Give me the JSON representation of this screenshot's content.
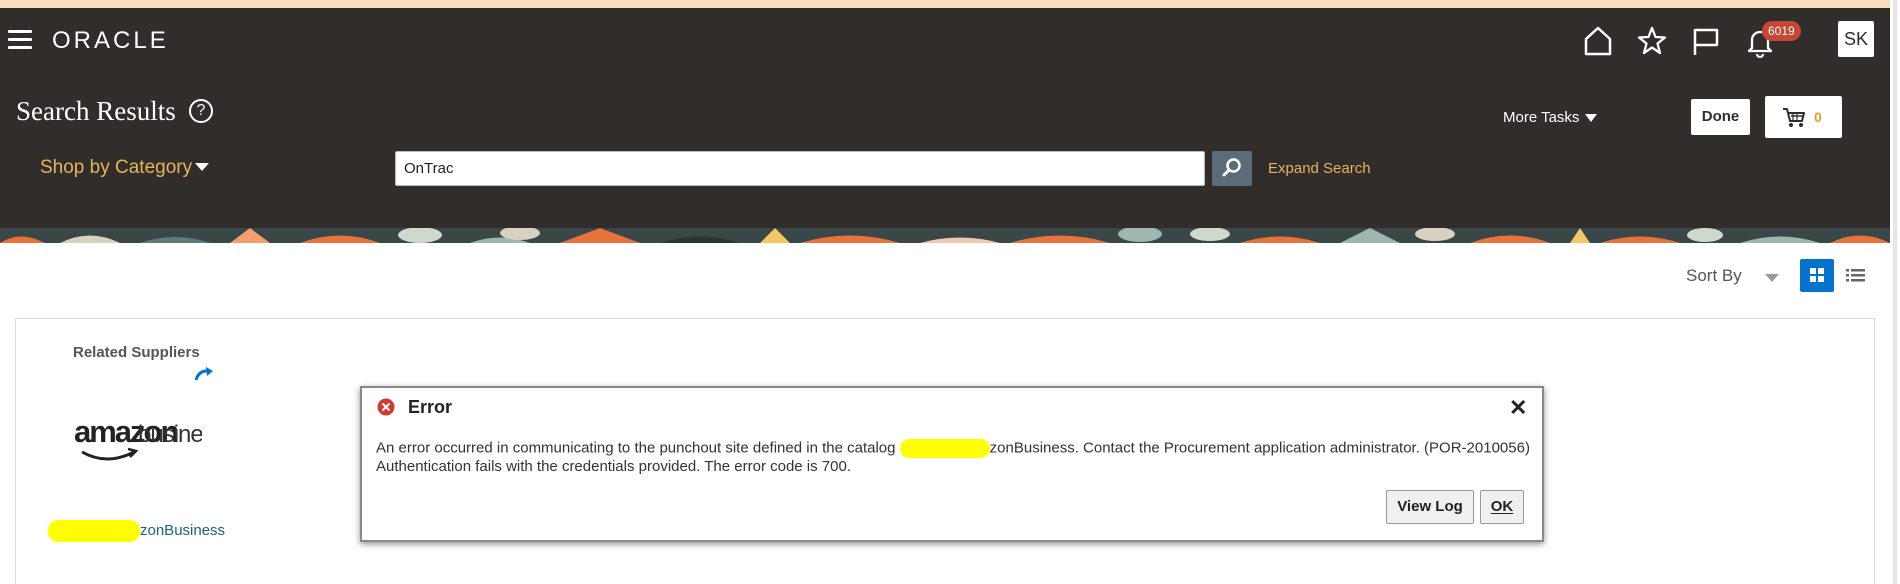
{
  "header": {
    "logo_text": "ORACLE",
    "notification_count": "6019",
    "avatar_initials": "SK",
    "page_title": "Search Results",
    "help_symbol": "?",
    "more_tasks_label": "More Tasks",
    "done_label": "Done",
    "cart_count": "0",
    "shop_by_category_label": "Shop by Category",
    "search_value": "OnTrac",
    "expand_search_label": "Expand Search",
    "icons": [
      "menu-icon",
      "home-icon",
      "favorites-star-icon",
      "flag-icon",
      "bell-icon",
      "cart-icon",
      "search-icon"
    ]
  },
  "toolbar": {
    "sort_by_label": "Sort By",
    "icons": [
      "grid-view-icon",
      "list-view-icon"
    ]
  },
  "related_suppliers": {
    "title": "Related Suppliers",
    "supplier_name_suffix": "zonBusiness",
    "logo_text_main": "amazon",
    "logo_text_sub": "business"
  },
  "dialog": {
    "title": "Error",
    "message_part1": "An error occurred in communicating to the punchout site defined in the catalog",
    "message_part2": "zonBusiness. Contact the Procurement application administrator. (POR-2010056)",
    "message_line2": "Authentication fails with the credentials provided. The error code is 700.",
    "view_log_label": "View Log",
    "ok_label": "OK",
    "close_symbol": "✕"
  },
  "colors": {
    "header_bg": "#312d2a",
    "accent_gold": "#e2b55a",
    "badge_red": "#c74634",
    "primary_blue": "#0572ce",
    "redaction_yellow": "#ffff00"
  }
}
